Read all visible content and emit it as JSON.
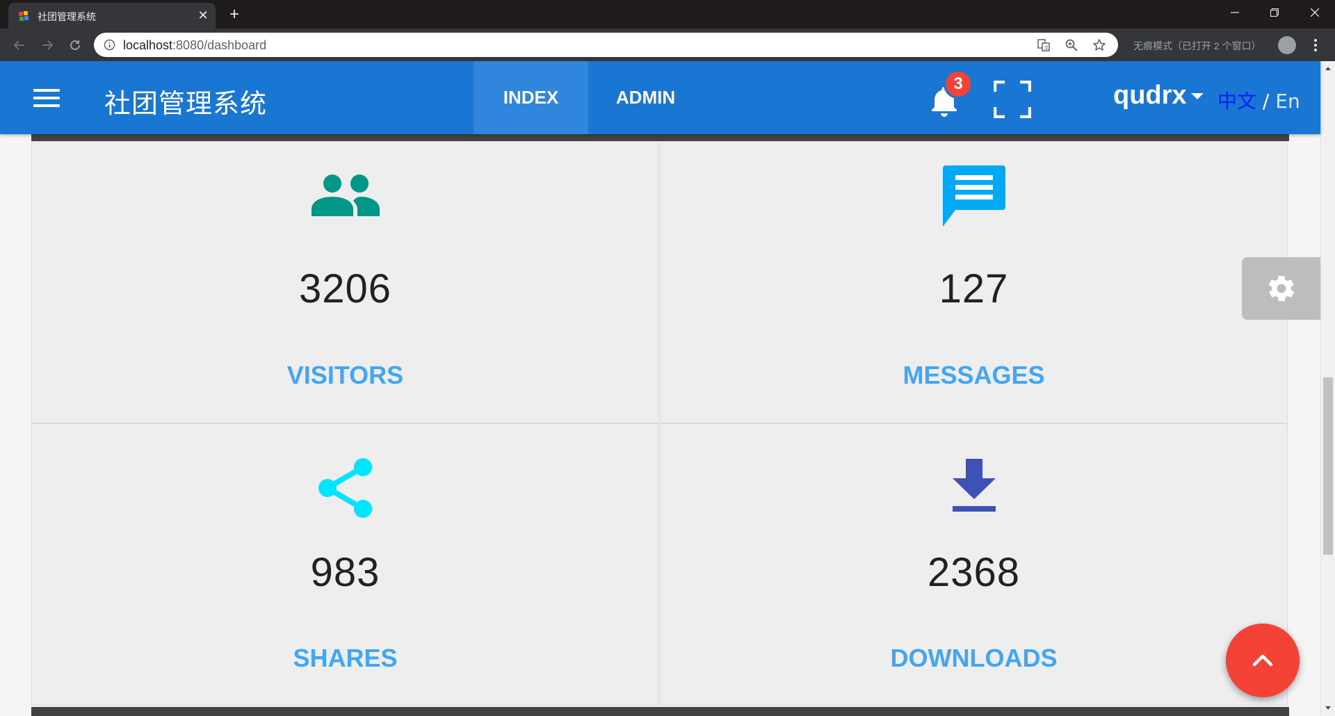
{
  "browser": {
    "tab_title": "社团管理系统",
    "tab_close": "✕",
    "new_tab": "+",
    "url_host": "localhost",
    "url_rest": ":8080/dashboard",
    "incognito_text": "无痕模式（已打开 2 个窗口）"
  },
  "app": {
    "title": "社团管理系统",
    "nav_tabs": [
      {
        "label": "INDEX",
        "active": true
      },
      {
        "label": "ADMIN",
        "active": false
      }
    ],
    "notification_count": "3",
    "user_name": "qudrx",
    "lang_zh": "中文",
    "lang_sep": "/",
    "lang_en": "En"
  },
  "stats": [
    {
      "icon": "people-icon",
      "value": "3206",
      "label": "VISITORS",
      "icon_color": "#009688"
    },
    {
      "icon": "message-icon",
      "value": "127",
      "label": "MESSAGES",
      "icon_color": "#03a9f4"
    },
    {
      "icon": "share-icon",
      "value": "983",
      "label": "SHARES",
      "icon_color": "#00e5ff"
    },
    {
      "icon": "download-icon",
      "value": "2368",
      "label": "DOWNLOADS",
      "icon_color": "#3f51b5"
    }
  ],
  "colors": {
    "appbar": "#1976d2",
    "label": "#42a5f5",
    "fab": "#f44336",
    "badge": "#f44336"
  }
}
